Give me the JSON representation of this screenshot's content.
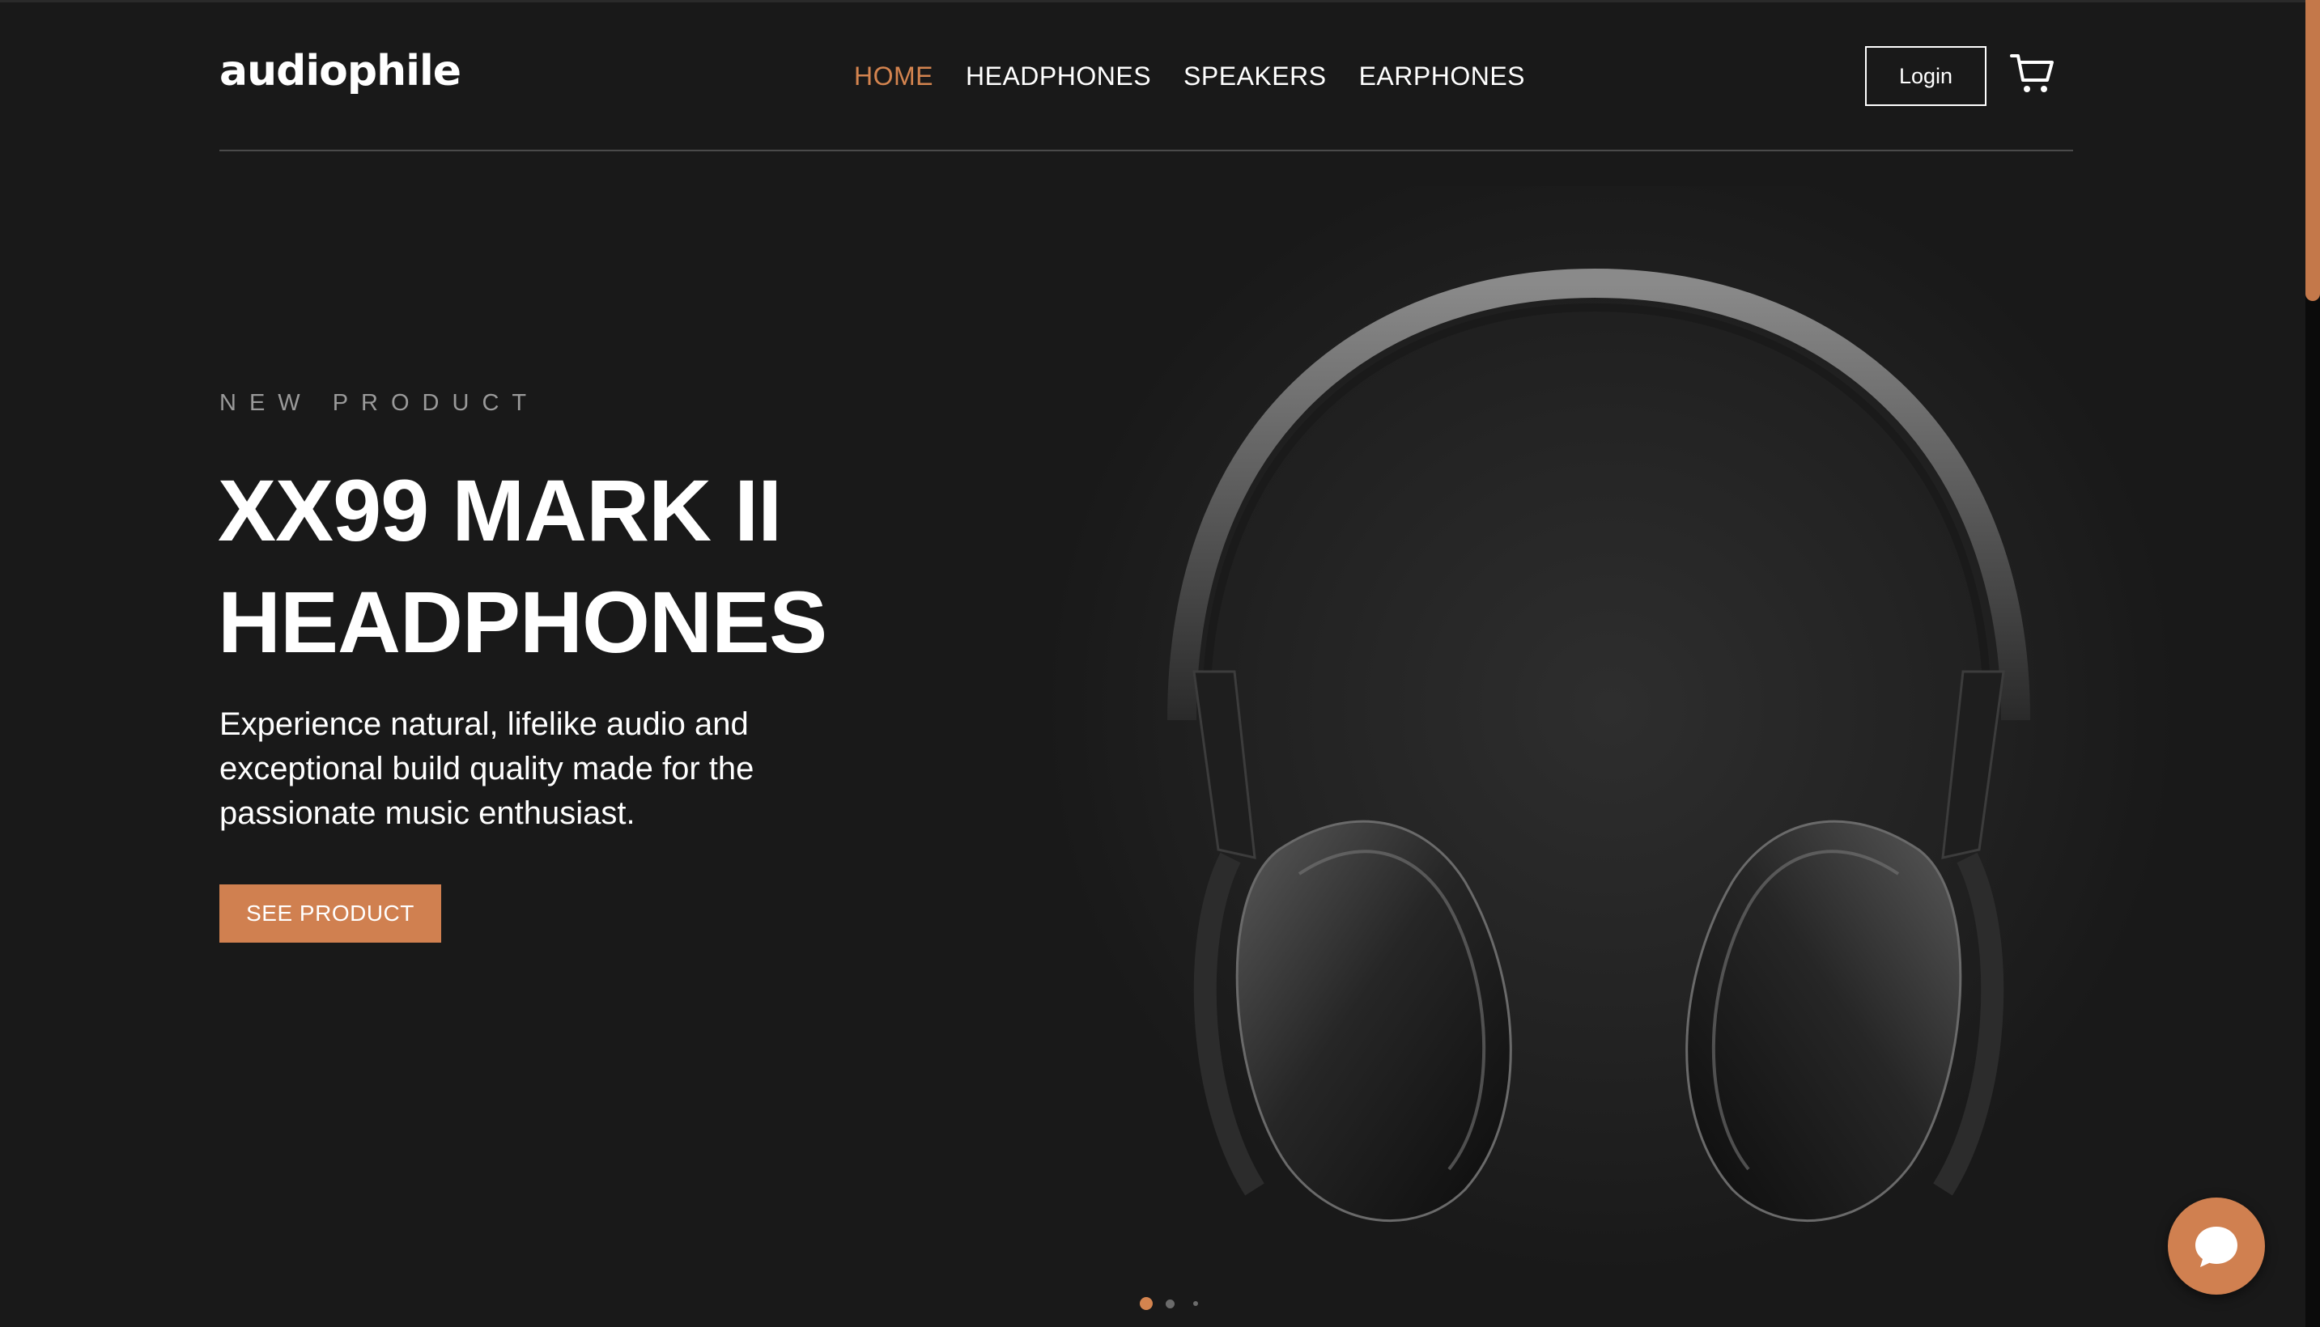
{
  "brand": {
    "logo_text": "audiophile"
  },
  "nav": {
    "items": [
      {
        "label": "HOME",
        "active": true
      },
      {
        "label": "HEADPHONES",
        "active": false
      },
      {
        "label": "SPEAKERS",
        "active": false
      },
      {
        "label": "EARPHONES",
        "active": false
      }
    ],
    "login_label": "Login",
    "cart_icon": "cart-icon"
  },
  "hero": {
    "eyebrow": "NEW PRODUCT",
    "title_line1": "XX99 MARK II",
    "title_line2": "HEADPHONES",
    "description": "Experience natural, lifelike audio and exceptional build quality made for the passionate music enthusiast.",
    "cta_label": "SEE PRODUCT",
    "image_subject": "black over-ear headphones"
  },
  "slider": {
    "count": 3,
    "active_index": 0
  },
  "chat": {
    "icon": "chat-bubble-icon"
  },
  "colors": {
    "background": "#191919",
    "accent": "#d08050",
    "active_nav": "#d4844f",
    "text": "#ffffff",
    "muted": "#9a9a9a"
  }
}
